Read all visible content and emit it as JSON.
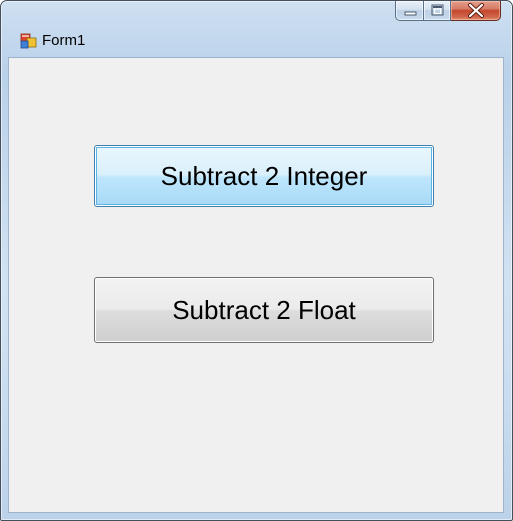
{
  "window": {
    "title": "Form1",
    "icon": "form-app-icon",
    "caption_buttons": [
      "minimize",
      "maximize",
      "close"
    ]
  },
  "buttons": {
    "subtract_integer_label": "Subtract 2 Integer",
    "subtract_float_label": "Subtract 2 Float"
  },
  "colors": {
    "client_background": "#f0f0f0",
    "focused_button_border": "#3c7fb1",
    "button_border": "#707070",
    "close_button": "#c3472c"
  }
}
